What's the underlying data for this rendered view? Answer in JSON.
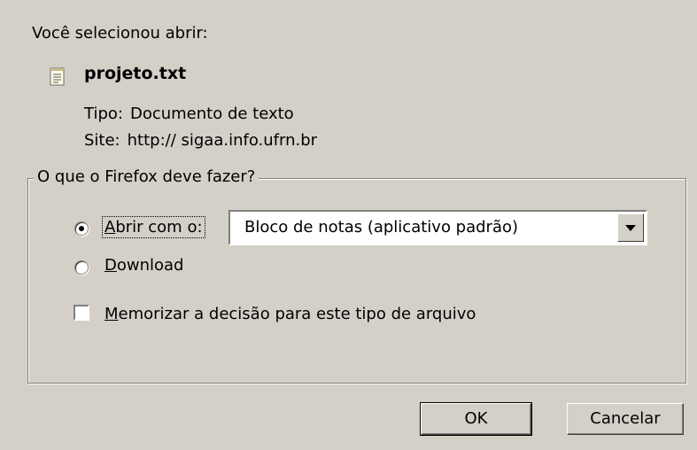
{
  "dialog": {
    "intro": "Você selecionou abrir:",
    "file": {
      "name": "projeto.txt",
      "type_label": "Tipo:",
      "type_value": "Documento de texto",
      "site_label": "Site:",
      "site_value": "http:// sigaa.info.ufrn.br"
    },
    "group_title": "O que o Firefox deve fazer?",
    "open_with": {
      "access_key": "A",
      "label_rest": "brir com o:",
      "selected": true
    },
    "app_select": {
      "value": "Bloco de notas (aplicativo padrão)"
    },
    "download": {
      "access_key": "D",
      "label_rest": "ownload",
      "selected": false
    },
    "remember": {
      "access_key": "M",
      "label_rest": "emorizar a decisão para este tipo de arquivo",
      "checked": false
    },
    "buttons": {
      "ok": "OK",
      "cancel": "Cancelar"
    }
  }
}
